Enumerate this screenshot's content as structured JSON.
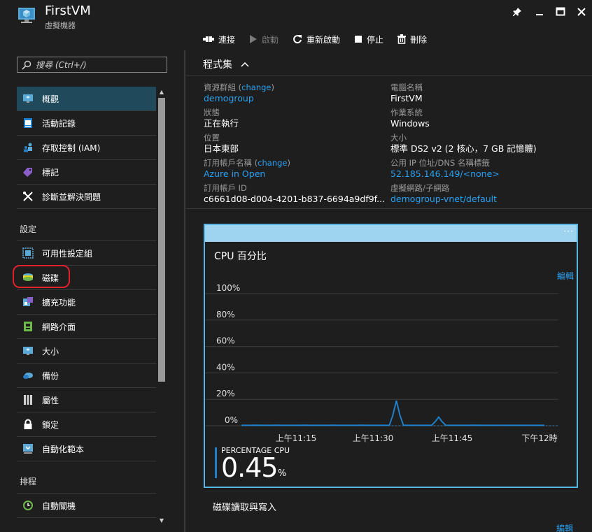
{
  "header": {
    "title": "FirstVM",
    "subtitle": "虛擬機器",
    "icon": "virtual-machine-icon"
  },
  "toolbar": {
    "connect": "連接",
    "start": "啟動",
    "restart": "重新啟動",
    "stop": "停止",
    "delete": "刪除"
  },
  "sidebar": {
    "search_placeholder": "搜尋 (Ctrl+/)",
    "items_top": [
      {
        "label": "概觀",
        "icon": "overview-icon",
        "active": true
      },
      {
        "label": "活動記錄",
        "icon": "activity-log-icon"
      },
      {
        "label": "存取控制 (IAM)",
        "icon": "access-control-icon"
      },
      {
        "label": "標記",
        "icon": "tag-icon"
      },
      {
        "label": "診斷並解決問題",
        "icon": "tools-icon"
      }
    ],
    "section_settings": "設定",
    "items_settings": [
      {
        "label": "可用性設定組",
        "icon": "availability-set-icon"
      },
      {
        "label": "磁碟",
        "icon": "disk-icon"
      },
      {
        "label": "擴充功能",
        "icon": "extensions-icon"
      },
      {
        "label": "網路介面",
        "icon": "network-interface-icon"
      },
      {
        "label": "大小",
        "icon": "size-icon"
      },
      {
        "label": "備份",
        "icon": "backup-icon"
      },
      {
        "label": "屬性",
        "icon": "properties-icon"
      },
      {
        "label": "鎖定",
        "icon": "lock-icon"
      },
      {
        "label": "自動化範本",
        "icon": "automation-script-icon"
      }
    ],
    "section_schedule": "排程",
    "items_schedule": [
      {
        "label": "自動關機",
        "icon": "auto-shutdown-icon"
      }
    ]
  },
  "essentials": {
    "header": "程式集",
    "resource_group_label": "資源群組",
    "change": "change",
    "resource_group_value": "demogroup",
    "status_label": "狀態",
    "status_value": "正在執行",
    "location_label": "位置",
    "location_value": "日本東部",
    "subscription_name_label": "訂用帳戶名稱",
    "subscription_name_value": "Azure in Open",
    "subscription_id_label": "訂用帳戶 ID",
    "subscription_id_value": "c6661d08-d004-4201-b837-6694a9df9f...",
    "computer_name_label": "電腦名稱",
    "computer_name_value": "FirstVM",
    "os_label": "作業系統",
    "os_value": "Windows",
    "size_label": "大小",
    "size_value": "標準 DS2 v2 (2 核心，7 GB 記憶體)",
    "public_ip_label": "公用 IP 位址/DNS 名稱標籤",
    "public_ip_value": "52.185.146.149/<none>",
    "vnet_label": "虛擬網路/子網路",
    "vnet_value": "demogroup-vnet/default"
  },
  "cpu_tile": {
    "title": "CPU 百分比",
    "edit": "編輯",
    "metric_label": "PERCENTAGE CPU",
    "metric_value": "0.45",
    "metric_unit": "%",
    "tile_menu": "···"
  },
  "disk_tile": {
    "title": "磁碟讀取與寫入",
    "edit": "編輯"
  },
  "chart_data": {
    "type": "line",
    "y_ticks": [
      "100%",
      "80%",
      "60%",
      "40%",
      "20%",
      "0%"
    ],
    "x_ticks": [
      "上午11:15",
      "上午11:30",
      "上午11:45",
      "下午12時"
    ],
    "ylim": [
      0,
      100
    ],
    "x": [
      0,
      4,
      8,
      12,
      16,
      20,
      24,
      28,
      32,
      36,
      40,
      44,
      48,
      52,
      56,
      60,
      64,
      68,
      72,
      76,
      80,
      84,
      86,
      88,
      90,
      92,
      96,
      100,
      104,
      108,
      110,
      112,
      114,
      116,
      120,
      124,
      128,
      132,
      136,
      140,
      144,
      148,
      152,
      156,
      160,
      164,
      168,
      172
    ],
    "values": [
      0.3,
      0.3,
      0.4,
      0.3,
      0.3,
      0.4,
      0.3,
      0.3,
      0.3,
      0.4,
      0.3,
      0.3,
      0.3,
      0.4,
      0.3,
      0.3,
      0.3,
      0.4,
      0.3,
      0.3,
      0.3,
      0.3,
      8,
      19,
      8,
      0.4,
      0.3,
      0.3,
      0.3,
      0.3,
      3,
      6.5,
      3,
      0.4,
      0.3,
      0.3,
      0.3,
      0.4,
      0.3,
      0.3,
      0.3,
      0.3,
      0.3,
      0.3,
      0.3,
      0.3,
      0.3,
      0.3
    ],
    "xlim": [
      0,
      180
    ],
    "series": [
      {
        "color": "#1f7fc9"
      }
    ],
    "grid": true
  }
}
